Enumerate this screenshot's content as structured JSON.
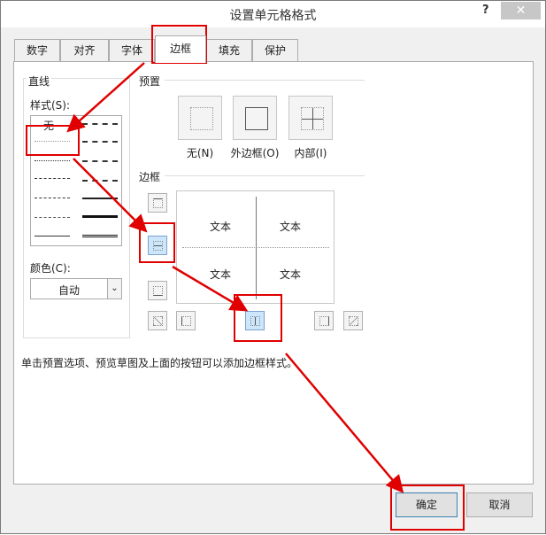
{
  "window": {
    "title": "设置单元格格式",
    "help_label": "?",
    "close_label": "✕"
  },
  "tabs": [
    {
      "label": "数字"
    },
    {
      "label": "对齐"
    },
    {
      "label": "字体"
    },
    {
      "label": "边框"
    },
    {
      "label": "填充"
    },
    {
      "label": "保护"
    }
  ],
  "line_group": {
    "title": "直线",
    "style_label": "样式(S):",
    "none_label": "无",
    "color_label": "颜色(C):",
    "color_value": "自动"
  },
  "presets": {
    "title": "预置",
    "items": [
      {
        "label": "无(N)"
      },
      {
        "label": "外边框(O)"
      },
      {
        "label": "内部(I)"
      }
    ]
  },
  "border_group": {
    "title": "边框",
    "cell_text": [
      "文本",
      "文本",
      "文本",
      "文本"
    ]
  },
  "hint": "单击预置选项、预览草图及上面的按钮可以添加边框样式。",
  "buttons": {
    "ok": "确定",
    "cancel": "取消"
  },
  "colors": {
    "annotation": "#e00000",
    "selected_button": "#cce6fb"
  }
}
